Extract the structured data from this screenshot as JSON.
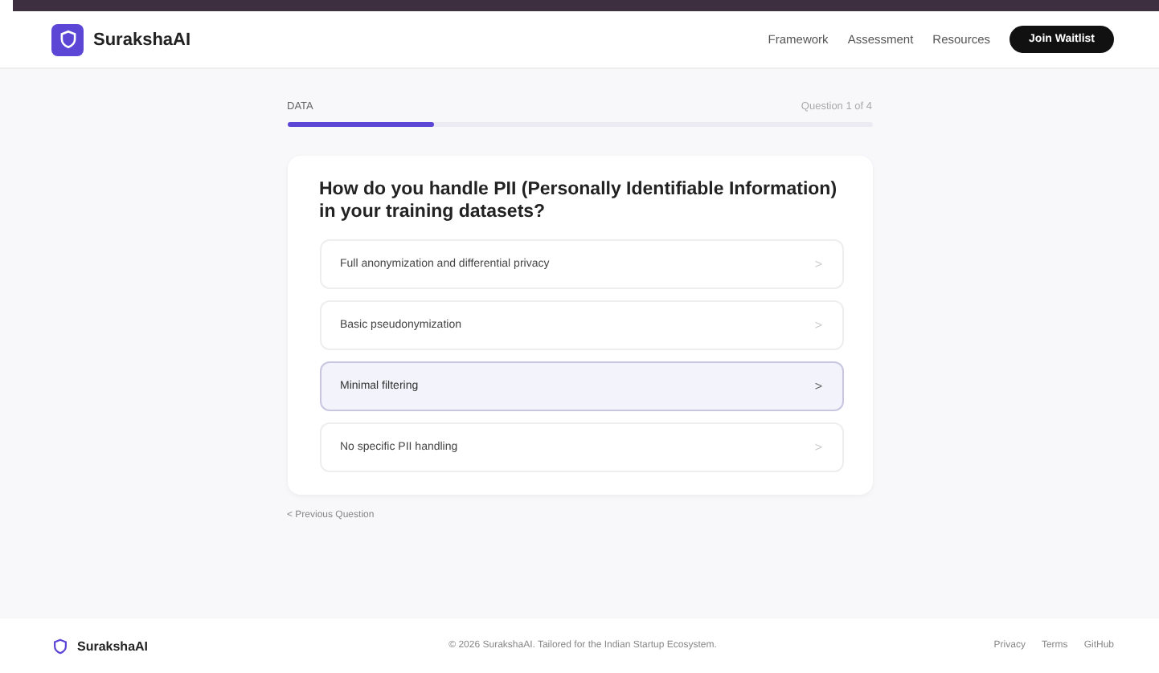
{
  "brand": "SurakshaAI",
  "nav": [
    "Framework",
    "Assessment",
    "Resources"
  ],
  "cta": "Join Waitlist",
  "progress": {
    "category": "DATA",
    "counter": "Question 1 of 4",
    "level": 0.25
  },
  "question": "How do you handle PII (Personally Identifiable Information) in your training datasets?",
  "options": [
    {
      "label": "Full anonymization and differential privacy",
      "selected": false
    },
    {
      "label": "Basic pseudonymization",
      "selected": false
    },
    {
      "label": "Minimal filtering",
      "selected": true
    },
    {
      "label": "No specific PII handling",
      "selected": false
    }
  ],
  "chevron": ">",
  "back": "< Previous Question",
  "footer": {
    "brand": "SurakshaAI",
    "copyright": "© 2026 SurakshaAI. Tailored for the Indian Startup Ecosystem.",
    "links": [
      "Privacy",
      "Terms",
      "GitHub"
    ]
  }
}
